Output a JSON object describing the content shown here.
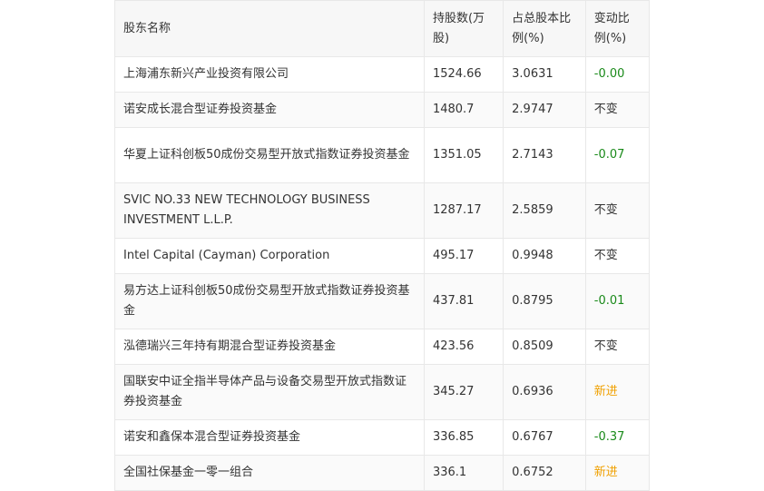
{
  "table": {
    "headers": [
      "股东名称",
      "持股数(万股)",
      "占总股本比例(%)",
      "变动比例(%)"
    ],
    "colors": {
      "negative": "#1a8a1a",
      "neutral": "#333333",
      "new_entry": "#f0a000"
    },
    "rows": [
      {
        "name": "上海浦东新兴产业投资有限公司",
        "shares": "1524.66",
        "pct": "3.0631",
        "change": "-0.00",
        "change_type": "negative"
      },
      {
        "name": "诺安成长混合型证券投资基金",
        "shares": "1480.7",
        "pct": "2.9747",
        "change": "不变",
        "change_type": "neutral"
      },
      {
        "name": "华夏上证科创板50成份交易型开放式指数证券投资基金",
        "shares": "1351.05",
        "pct": "2.7143",
        "change": "-0.07",
        "change_type": "negative"
      },
      {
        "name": "SVIC NO.33 NEW TECHNOLOGY BUSINESS INVESTMENT L.L.P.",
        "shares": "1287.17",
        "pct": "2.5859",
        "change": "不变",
        "change_type": "neutral"
      },
      {
        "name": "Intel Capital (Cayman) Corporation",
        "shares": "495.17",
        "pct": "0.9948",
        "change": "不变",
        "change_type": "neutral"
      },
      {
        "name": "易方达上证科创板50成份交易型开放式指数证券投资基金",
        "shares": "437.81",
        "pct": "0.8795",
        "change": "-0.01",
        "change_type": "negative"
      },
      {
        "name": "泓德瑞兴三年持有期混合型证券投资基金",
        "shares": "423.56",
        "pct": "0.8509",
        "change": "不变",
        "change_type": "neutral"
      },
      {
        "name": "国联安中证全指半导体产品与设备交易型开放式指数证券投资基金",
        "shares": "345.27",
        "pct": "0.6936",
        "change": "新进",
        "change_type": "new_entry"
      },
      {
        "name": "诺安和鑫保本混合型证券投资基金",
        "shares": "336.85",
        "pct": "0.6767",
        "change": "-0.37",
        "change_type": "negative"
      },
      {
        "name": "全国社保基金一零一组合",
        "shares": "336.1",
        "pct": "0.6752",
        "change": "新进",
        "change_type": "new_entry"
      }
    ]
  }
}
